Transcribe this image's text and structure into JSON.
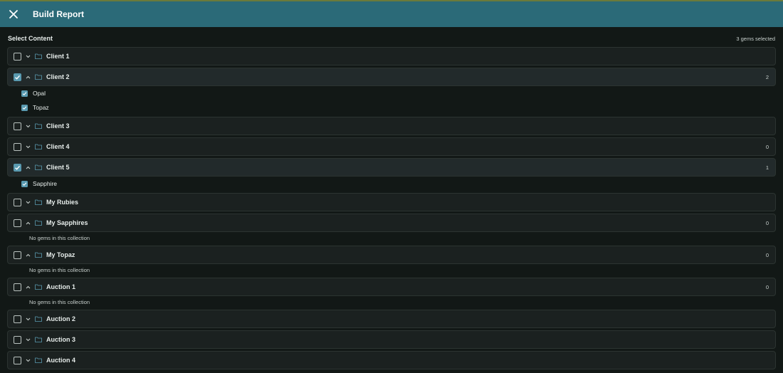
{
  "header": {
    "title": "Build Report",
    "close_icon": "close-icon"
  },
  "selection": {
    "label": "Select Content",
    "count_text": "3 gems selected"
  },
  "accent_color": "#5a9ab0",
  "collections": [
    {
      "label": "Client 1",
      "checked": false,
      "expanded": false,
      "count": ""
    },
    {
      "label": "Client 2",
      "checked": true,
      "expanded": true,
      "count": "2",
      "items": [
        "Opal",
        "Topaz"
      ]
    },
    {
      "label": "Client 3",
      "checked": false,
      "expanded": false,
      "count": ""
    },
    {
      "label": "Client 4",
      "checked": false,
      "expanded": false,
      "count": "0"
    },
    {
      "label": "Client 5",
      "checked": true,
      "expanded": true,
      "count": "1",
      "items": [
        "Sapphire"
      ]
    },
    {
      "label": "My Rubies",
      "checked": false,
      "expanded": false,
      "count": ""
    },
    {
      "label": "My Sapphires",
      "checked": false,
      "expanded": true,
      "count": "0",
      "empty_text": "No gems in this collection"
    },
    {
      "label": "My Topaz",
      "checked": false,
      "expanded": true,
      "count": "0",
      "empty_text": "No gems in this collection"
    },
    {
      "label": "Auction 1",
      "checked": false,
      "expanded": true,
      "count": "0",
      "empty_text": "No gems in this collection"
    },
    {
      "label": "Auction 2",
      "checked": false,
      "expanded": false,
      "count": ""
    },
    {
      "label": "Auction 3",
      "checked": false,
      "expanded": false,
      "count": ""
    },
    {
      "label": "Auction 4",
      "checked": false,
      "expanded": false,
      "count": ""
    }
  ]
}
